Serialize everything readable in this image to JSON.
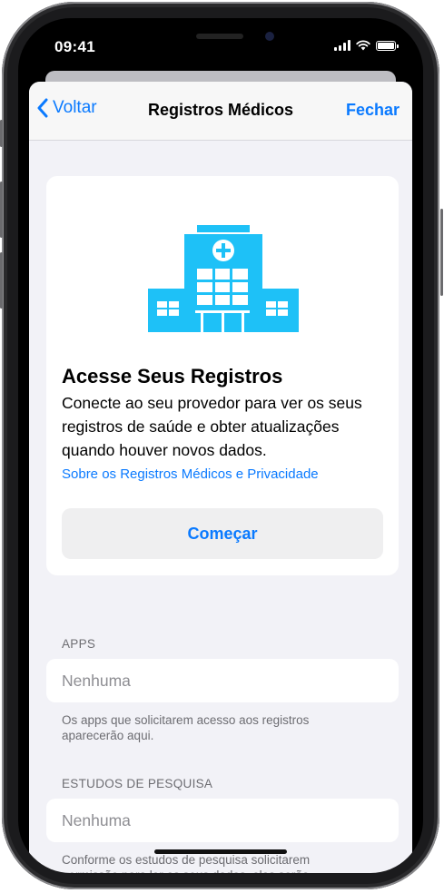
{
  "status_bar": {
    "time": "09:41"
  },
  "nav": {
    "back_label": "Voltar",
    "title": "Registros Médicos",
    "close_label": "Fechar"
  },
  "card": {
    "title": "Acesse Seus Registros",
    "description": "Conecte ao seu provedor para ver os seus registros de saúde e obter atualizações quando houver novos dados.",
    "link": "Sobre os Registros Médicos e Privacidade",
    "button": "Começar"
  },
  "apps": {
    "header": "APPS",
    "value": "Nenhuma",
    "footer": "Os apps que solicitarem acesso aos registros aparecerão aqui."
  },
  "studies": {
    "header": "ESTUDOS DE PESQUISA",
    "value": "Nenhuma",
    "footer": "Conforme os estudos de pesquisa solicitarem permissão para ler os seus dados, eles serão"
  },
  "icons": {
    "back": "chevron-left-icon",
    "hospital": "hospital-icon",
    "wifi": "wifi-icon",
    "signal": "cellular-signal-icon",
    "battery": "battery-icon"
  },
  "colors": {
    "accent": "#0a7aff",
    "hospital_icon": "#1ec1f7",
    "background": "#f2f2f7"
  }
}
